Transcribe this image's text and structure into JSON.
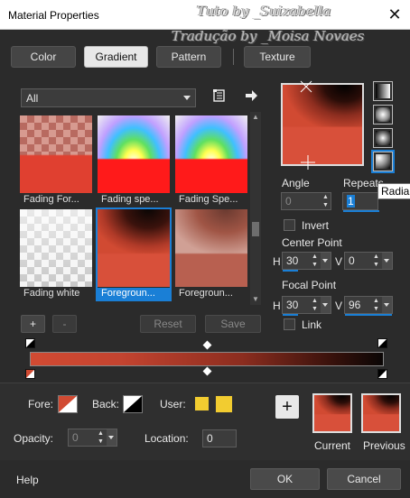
{
  "window": {
    "title": "Material Properties",
    "close_glyph": "✕"
  },
  "watermark": {
    "line1": "Tuto by _Suizabella",
    "line2": "Tradução by _Moisa Novaes"
  },
  "tabs": [
    {
      "label": "Color",
      "active": false
    },
    {
      "label": "Gradient",
      "active": true
    },
    {
      "label": "Pattern",
      "active": false
    },
    {
      "label": "Texture",
      "active": false
    }
  ],
  "filter": {
    "selected": "All"
  },
  "gallery": {
    "items": [
      {
        "label": "Fading For...",
        "selected": false
      },
      {
        "label": "Fading spe...",
        "selected": false
      },
      {
        "label": "Fading Spe...",
        "selected": false
      },
      {
        "label": "Fading white",
        "selected": false
      },
      {
        "label": "Foregroun...",
        "selected": true
      },
      {
        "label": "Foregroun...",
        "selected": false
      }
    ]
  },
  "gallery_buttons": {
    "add": "+",
    "remove": "-",
    "reset": "Reset",
    "save": "Save"
  },
  "style_buttons": [
    {
      "name": "linear-style-icon",
      "active": false
    },
    {
      "name": "rectangular-style-icon",
      "active": false
    },
    {
      "name": "radial-style-icon",
      "active": false
    },
    {
      "name": "sunburst-style-icon",
      "active": true
    }
  ],
  "angle": {
    "label": "Angle",
    "value": "0"
  },
  "repeats": {
    "label": "Repeats",
    "value": "1"
  },
  "tooltip": {
    "text": "Radial"
  },
  "invert": {
    "label": "Invert",
    "checked": false
  },
  "center_point": {
    "label": "Center Point",
    "h_label": "H",
    "h": "30",
    "v_label": "V",
    "v": "0"
  },
  "focal_point": {
    "label": "Focal Point",
    "h_label": "H",
    "h": "30",
    "v_label": "V",
    "v": "96"
  },
  "link": {
    "label": "Link",
    "checked": false
  },
  "bottom": {
    "fore_label": "Fore:",
    "back_label": "Back:",
    "user_label": "User:",
    "opacity_label": "Opacity:",
    "opacity_value": "0",
    "location_label": "Location:",
    "location_value": "0",
    "current_label": "Current",
    "previous_label": "Previous",
    "add_glyph": "+"
  },
  "colors": {
    "gradient_start": "#d14a32",
    "gradient_end": "#0a0605",
    "user_swatch": "#f2cc30",
    "accent": "#1a7fd6"
  },
  "footer": {
    "help": "Help",
    "ok": "OK",
    "cancel": "Cancel"
  }
}
